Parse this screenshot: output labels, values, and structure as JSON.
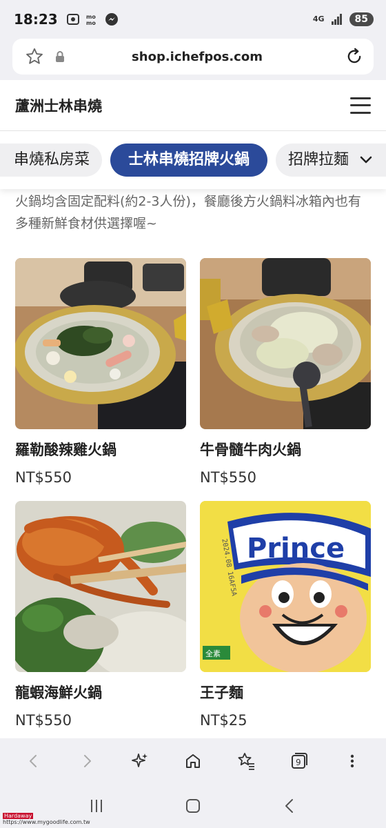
{
  "status_bar": {
    "time": "18:23",
    "network": "4G",
    "battery": "85"
  },
  "browser": {
    "url": "shop.ichefpos.com"
  },
  "site": {
    "title": "蘆洲士林串燒"
  },
  "categories": [
    {
      "label": "串燒私房菜",
      "active": false
    },
    {
      "label": "士林串燒招牌火鍋",
      "active": true
    },
    {
      "label": "招牌拉麵",
      "active": false
    }
  ],
  "description": "火鍋均含固定配料(約2-3人份)，餐廳後方火鍋料冰箱內也有多種新鮮食材供選擇喔~",
  "products": [
    {
      "name": "羅勒酸辣雞火鍋",
      "price": "NT$550"
    },
    {
      "name": "牛骨髓牛肉火鍋",
      "price": "NT$550"
    },
    {
      "name": "龍蝦海鮮火鍋",
      "price": "NT$550"
    },
    {
      "name": "王子麵",
      "price": "NT$25"
    }
  ],
  "bottom_bar": {
    "tabs_count": "9"
  },
  "image_text": {
    "prince_logo": "Prince",
    "package_text": "全素",
    "date_stamp": "2024.08 16AF5A"
  },
  "watermark": {
    "line1": "Hardaway",
    "line2": "https://www.mygoodlife.com.tw"
  },
  "colors": {
    "accent": "#2b4a9a",
    "background": "#f0f0f4"
  }
}
